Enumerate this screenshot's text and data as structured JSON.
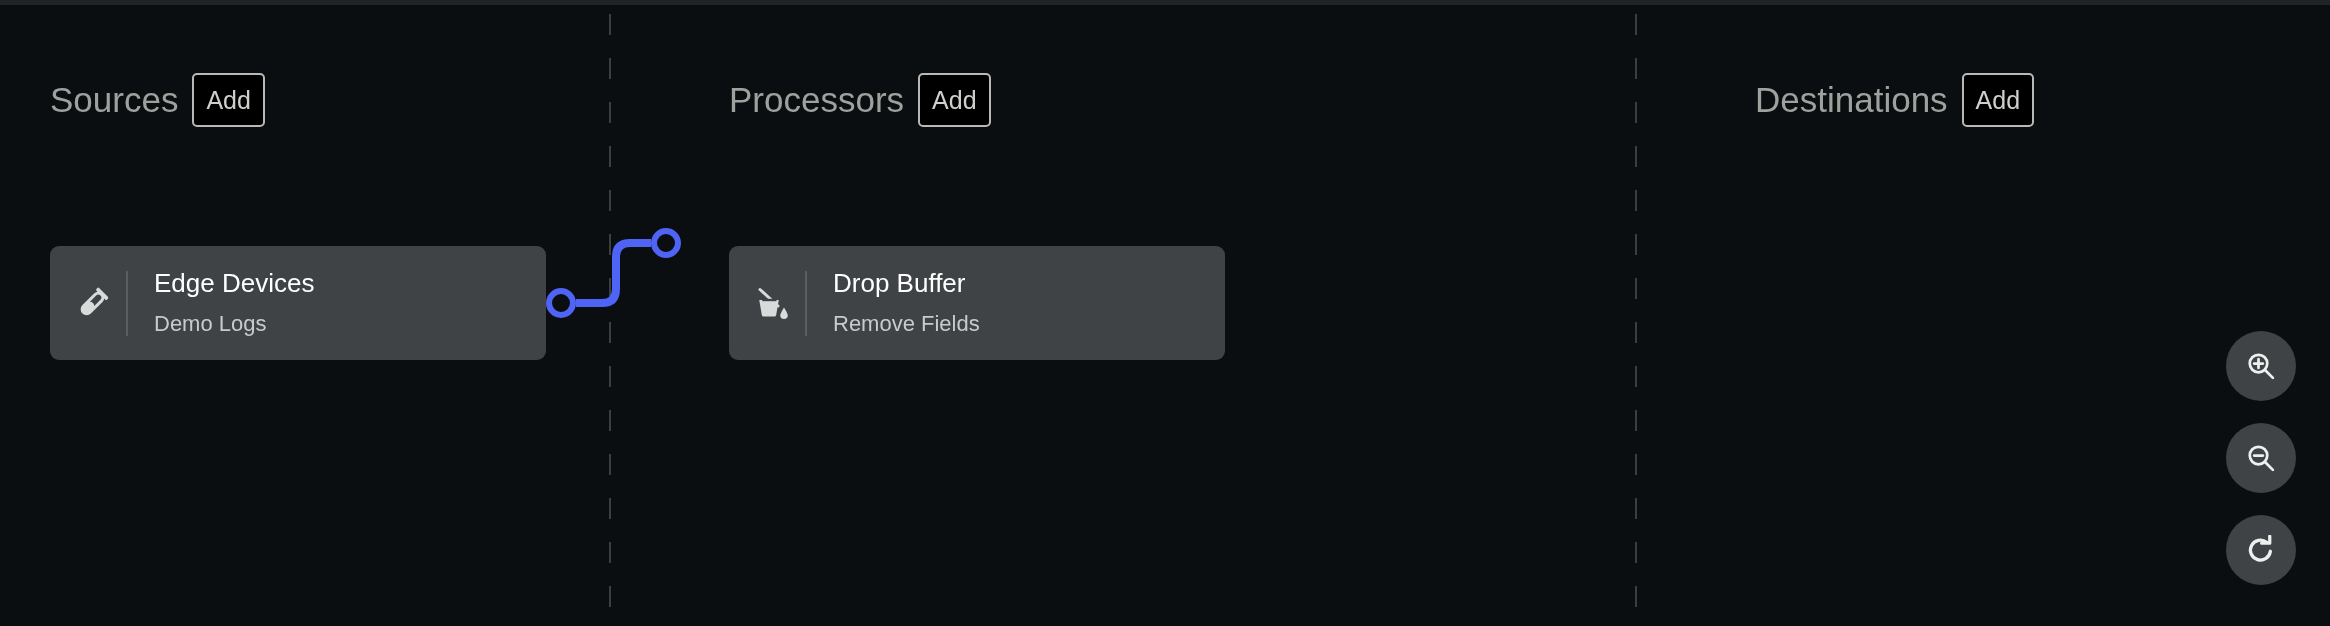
{
  "columns": [
    {
      "title": "Sources",
      "add_button": "Add",
      "nodes": [
        {
          "kind": "source",
          "title": "Edge Devices",
          "subtitle": "Demo Logs"
        }
      ]
    },
    {
      "title": "Processors",
      "add_button": "Add",
      "nodes": [
        {
          "kind": "processor",
          "title": "Drop Buffer",
          "subtitle": "Remove Fields"
        }
      ]
    },
    {
      "title": "Destinations",
      "add_button": "Add"
    }
  ]
}
